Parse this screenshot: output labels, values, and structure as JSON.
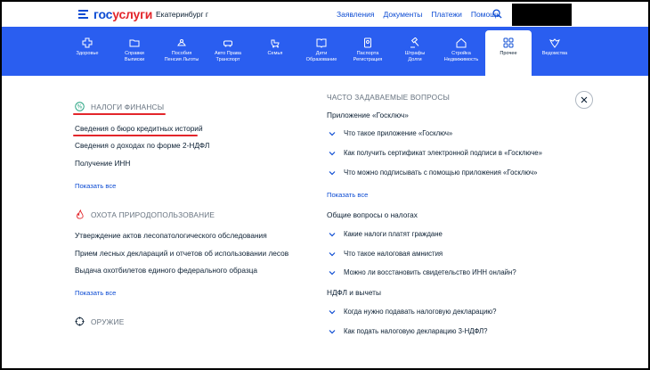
{
  "header": {
    "logo_part1": "гос",
    "logo_part2": "услуги",
    "city": "Екатеринбург г",
    "nav": [
      "Заявления",
      "Документы",
      "Платежи",
      "Помощь"
    ]
  },
  "categories": [
    {
      "label1": "Здоровье",
      "label2": "",
      "icon": "plus-icon"
    },
    {
      "label1": "Справки",
      "label2": "Выписки",
      "icon": "folder-icon"
    },
    {
      "label1": "Пособия",
      "label2": "Пенсия Льготы",
      "icon": "hand-coin-icon"
    },
    {
      "label1": "Авто Права",
      "label2": "Транспорт",
      "icon": "car-icon"
    },
    {
      "label1": "Семья",
      "label2": "",
      "icon": "stroller-icon"
    },
    {
      "label1": "Дети",
      "label2": "Образование",
      "icon": "book-icon"
    },
    {
      "label1": "Паспорта",
      "label2": "Регистрация",
      "icon": "passport-icon"
    },
    {
      "label1": "Штрафы",
      "label2": "Долги",
      "icon": "gavel-icon"
    },
    {
      "label1": "Стройка",
      "label2": "Недвижимость",
      "icon": "house-icon"
    },
    {
      "label1": "Прочее",
      "label2": "",
      "icon": "grid-icon"
    },
    {
      "label1": "Ведомства",
      "label2": "",
      "icon": "eagle-icon"
    }
  ],
  "left": {
    "taxes_title": "НАЛОГИ ФИНАНСЫ",
    "taxes_items": [
      "Сведения о бюро кредитных историй",
      "Сведения о доходах по форме 2-НДФЛ",
      "Получение ИНН"
    ],
    "show_all": "Показать все",
    "hunting_title": "ОХОТА ПРИРОДОПОЛЬЗОВАНИЕ",
    "hunting_items": [
      "Утверждение актов лесопатологического обследования",
      "Прием лесных деклараций и отчетов об использовании лесов",
      "Выдача охотбилетов единого федерального образца"
    ],
    "weapon_title": "ОРУЖИЕ"
  },
  "right": {
    "faq_title": "ЧАСТО ЗАДАВАЕМЫЕ ВОПРОСЫ",
    "group1": "Приложение «Госключ»",
    "group1_q": [
      "Что такое приложение «Госключ»",
      "Как получить сертификат электронной подписи в «Госключе»",
      "Что можно подписывать с помощью приложения «Госключ»"
    ],
    "show_all": "Показать все",
    "group2": "Общие вопросы о налогах",
    "group2_q": [
      "Какие налоги платят граждане",
      "Что такое налоговая амнистия",
      "Можно ли восстановить свидетельство ИНН онлайн?"
    ],
    "group3": "НДФЛ и вычеты",
    "group3_q": [
      "Когда нужно подавать налоговую декларацию?",
      "Как подать налоговую декларацию 3-НДФЛ?"
    ]
  },
  "colors": {
    "brand_blue": "#0d4cd3",
    "brand_red": "#e3262b",
    "bar_blue": "#2a5ef0"
  }
}
